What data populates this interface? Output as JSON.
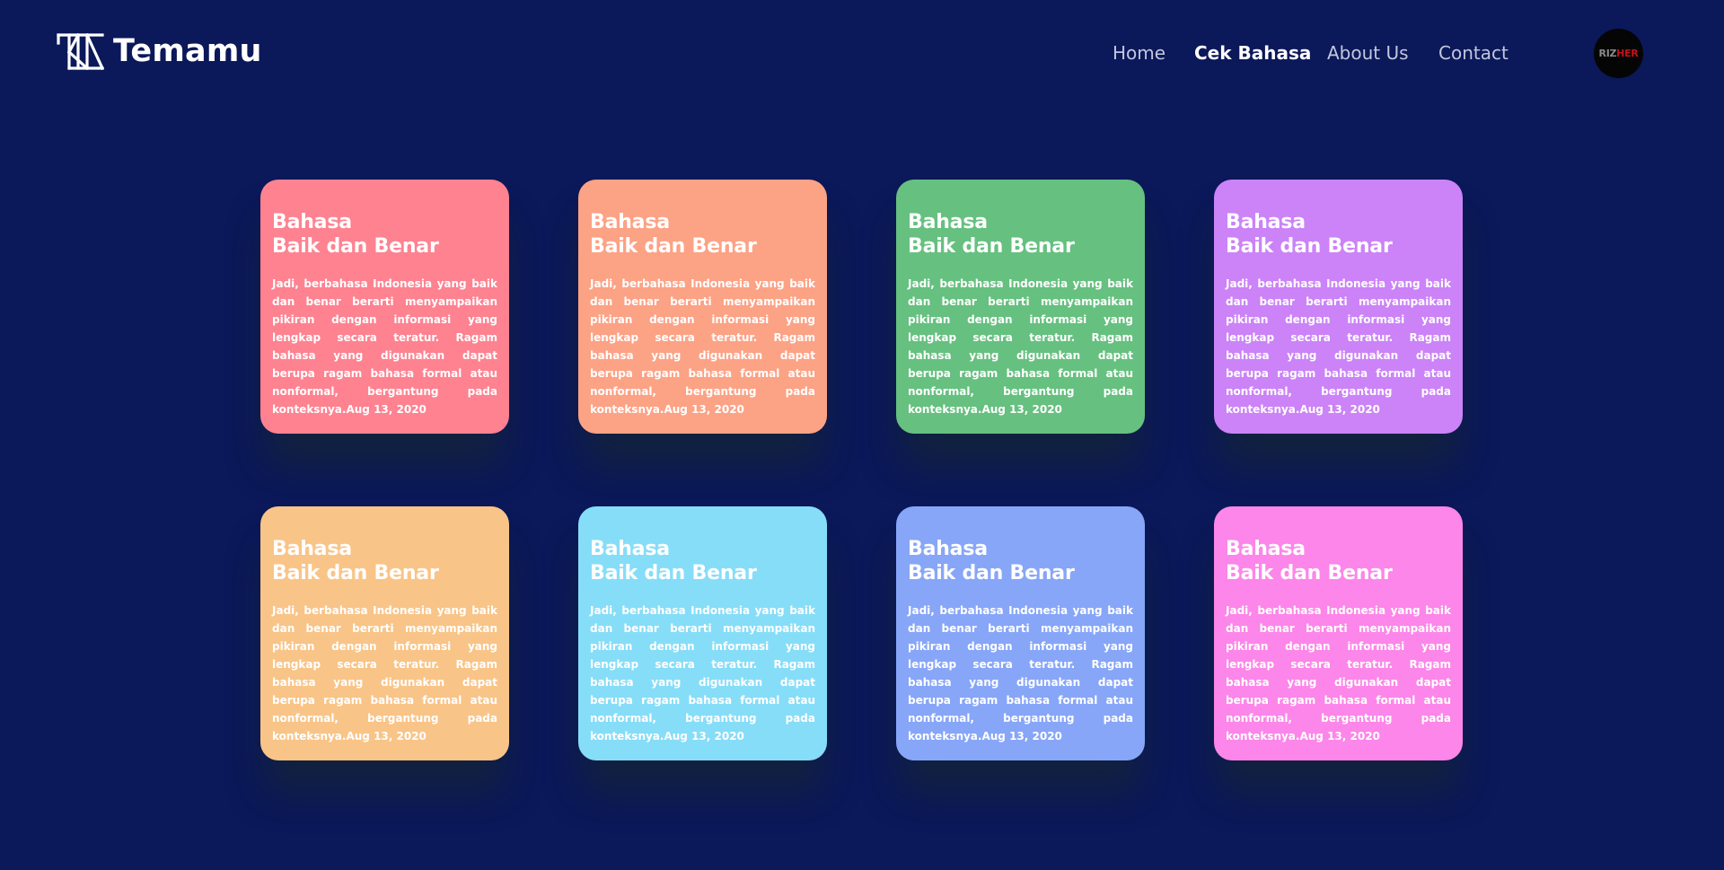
{
  "header": {
    "brand": "Temamu",
    "nav": [
      {
        "label": "Home",
        "active": false
      },
      {
        "label": "Cek Bahasa",
        "active": true
      },
      {
        "label": "About Us",
        "active": false
      },
      {
        "label": "Contact",
        "active": false
      }
    ],
    "avatar": {
      "part1": "RIZ",
      "part2": "HER"
    }
  },
  "cards": [
    {
      "title_line1": "Bahasa",
      "title_line2": "Baik dan Benar",
      "body": "Jadi, berbahasa Indonesia yang baik dan benar berarti menyampaikan pikiran dengan informasi yang lengkap secara teratur. Ragam bahasa yang digunakan dapat berupa ragam bahasa formal atau nonformal, bergantung pada konteksnya.",
      "date": "Aug 13, 2020",
      "color": "#fe8290"
    },
    {
      "title_line1": "Bahasa",
      "title_line2": "Baik dan Benar",
      "body": "Jadi, berbahasa Indonesia yang baik dan benar berarti menyampaikan pikiran dengan informasi yang lengkap secara teratur. Ragam bahasa yang digunakan dapat berupa ragam bahasa formal atau nonformal, bergantung pada konteksnya.",
      "date": "Aug 13, 2020",
      "color": "#fca285"
    },
    {
      "title_line1": "Bahasa",
      "title_line2": "Baik dan Benar",
      "body": "Jadi, berbahasa Indonesia yang baik dan benar berarti menyampaikan pikiran dengan informasi yang lengkap secara teratur. Ragam bahasa yang digunakan dapat berupa ragam bahasa formal atau nonformal, bergantung pada konteksnya.",
      "date": "Aug 13, 2020",
      "color": "#66c07f"
    },
    {
      "title_line1": "Bahasa",
      "title_line2": "Baik dan Benar",
      "body": "Jadi, berbahasa Indonesia yang baik dan benar berarti menyampaikan pikiran dengan informasi yang lengkap secara teratur. Ragam bahasa yang digunakan dapat berupa ragam bahasa formal atau nonformal, bergantung pada konteksnya.",
      "date": "Aug 13, 2020",
      "color": "#cb83f7"
    },
    {
      "title_line1": "Bahasa",
      "title_line2": "Baik dan Benar",
      "body": "Jadi, berbahasa Indonesia yang baik dan benar berarti menyampaikan pikiran dengan informasi yang lengkap secara teratur. Ragam bahasa yang digunakan dapat berupa ragam bahasa formal atau nonformal, bergantung pada konteksnya.",
      "date": "Aug 13, 2020",
      "color": "#f9c487"
    },
    {
      "title_line1": "Bahasa",
      "title_line2": "Baik dan Benar",
      "body": "Jadi, berbahasa Indonesia yang baik dan benar berarti menyampaikan pikiran dengan informasi yang lengkap secara teratur. Ragam bahasa yang digunakan dapat berupa ragam bahasa formal atau nonformal, bergantung pada konteksnya.",
      "date": "Aug 13, 2020",
      "color": "#86ddf8"
    },
    {
      "title_line1": "Bahasa",
      "title_line2": "Baik dan Benar",
      "body": "Jadi, berbahasa Indonesia yang baik dan benar berarti menyampaikan pikiran dengan informasi yang lengkap secara teratur. Ragam bahasa yang digunakan dapat berupa ragam bahasa formal atau nonformal, bergantung pada konteksnya.",
      "date": "Aug 13, 2020",
      "color": "#87a6f8"
    },
    {
      "title_line1": "Bahasa",
      "title_line2": "Baik dan Benar",
      "body": "Jadi, berbahasa Indonesia yang baik dan benar berarti menyampaikan pikiran dengan informasi yang lengkap secara teratur. Ragam bahasa yang digunakan dapat berupa ragam bahasa formal atau nonformal, bergantung pada konteksnya.",
      "date": "Aug 13, 2020",
      "color": "#fc86e9"
    }
  ]
}
